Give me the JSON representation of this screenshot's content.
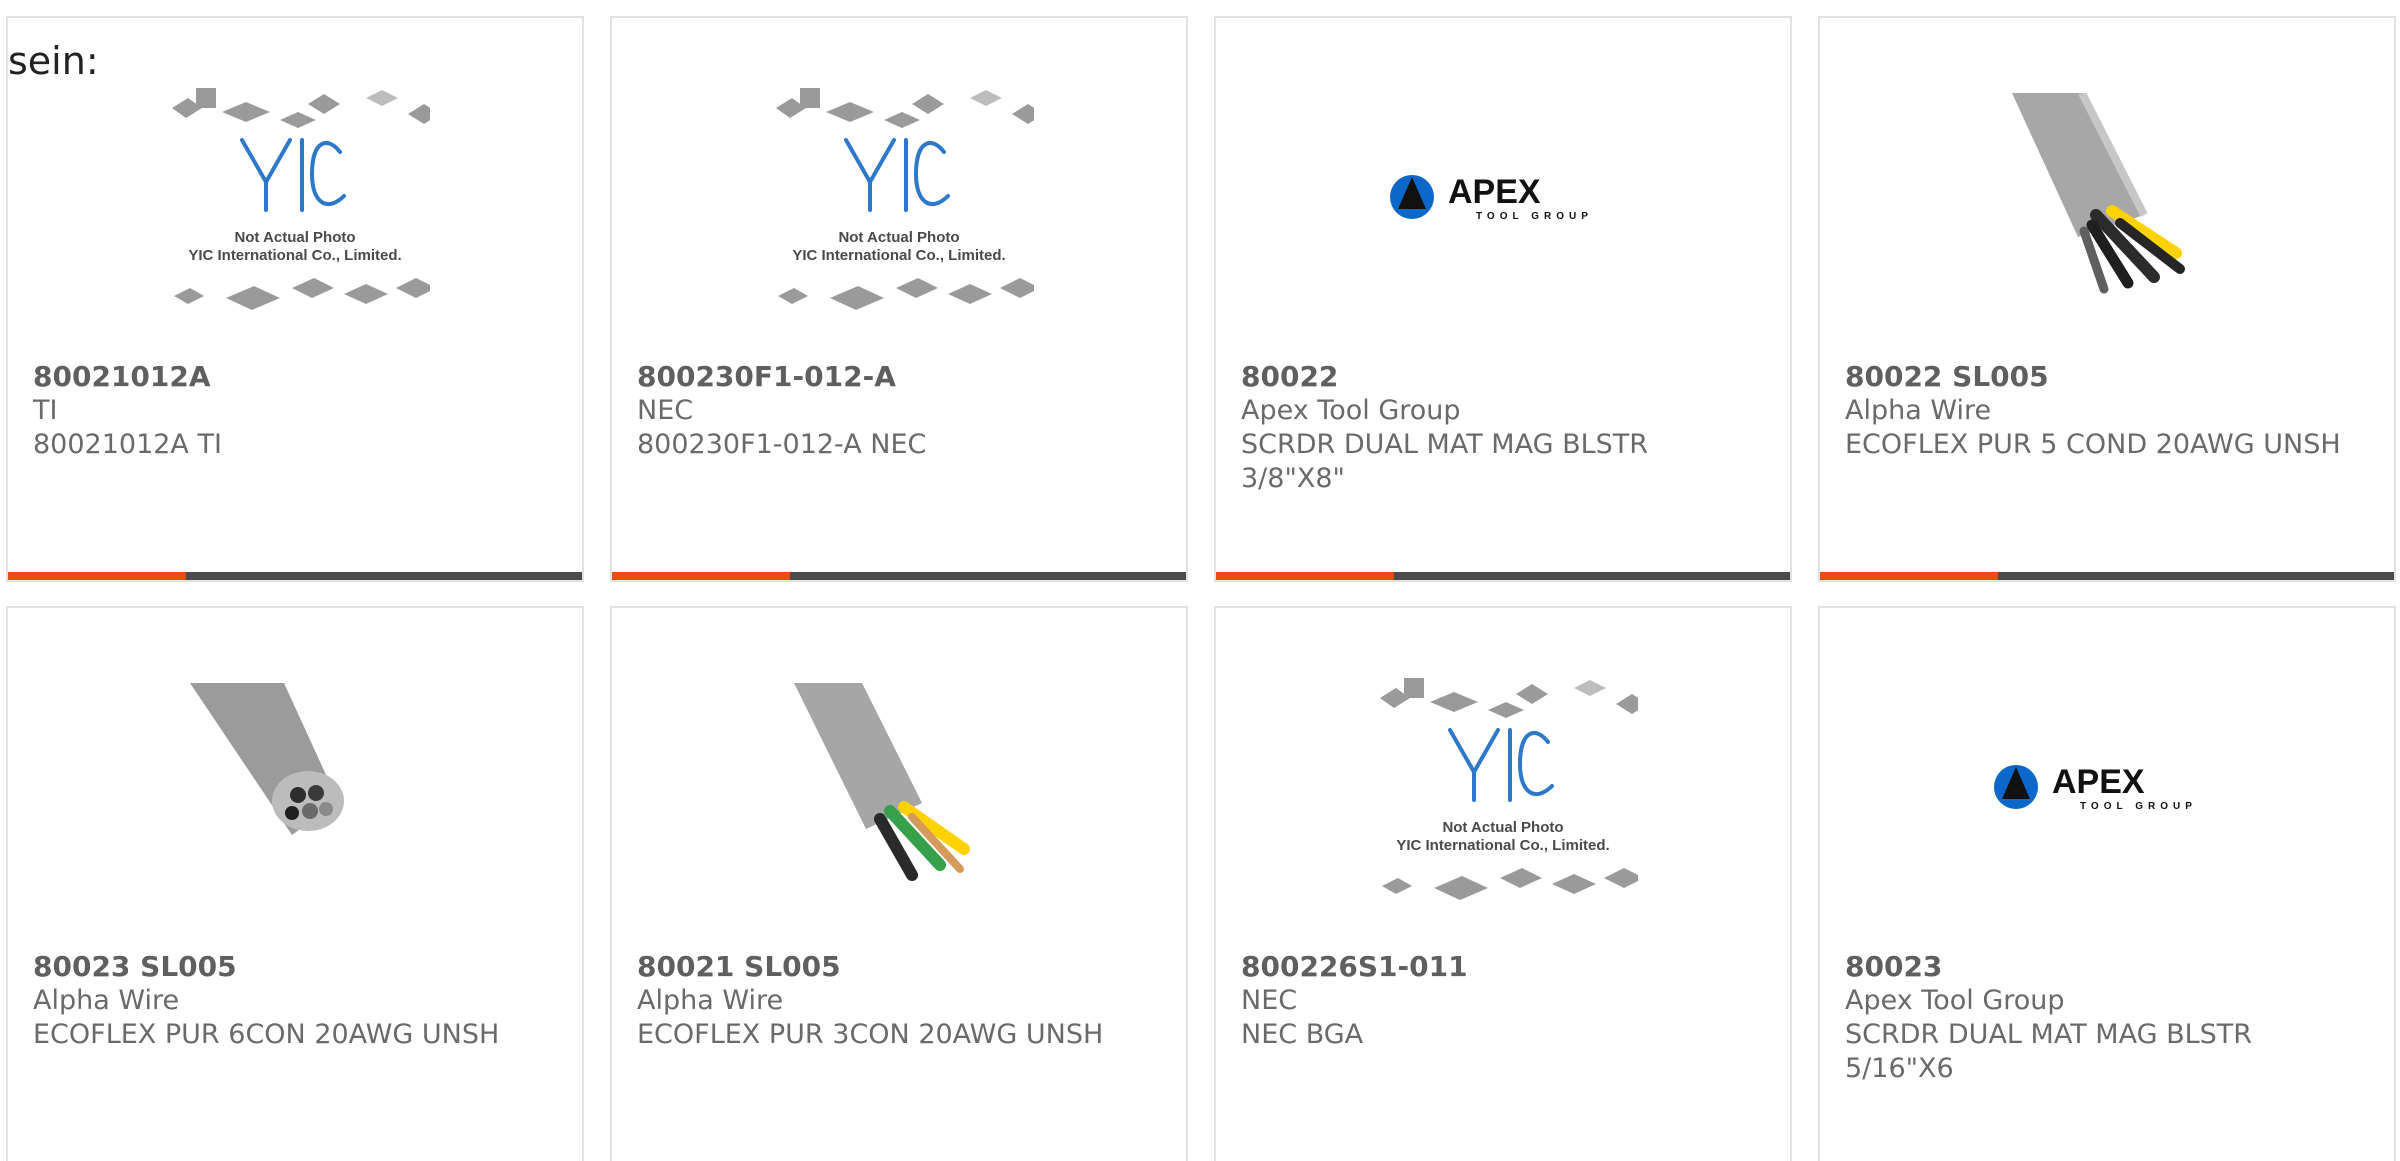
{
  "intro": "sein:",
  "products": [
    {
      "part_number": "80021012A",
      "brand": "TI",
      "description": "80021012A TI",
      "image": "yic-placeholder",
      "placeholder_text": [
        "Not Actual Photo",
        "YIC International Co., Limited."
      ]
    },
    {
      "part_number": "800230F1-012-A",
      "brand": "NEC",
      "description": "800230F1-012-A NEC",
      "image": "yic-placeholder",
      "placeholder_text": [
        "Not Actual Photo",
        "YIC International Co., Limited."
      ]
    },
    {
      "part_number": "80022",
      "brand": "Apex Tool Group",
      "description": "SCRDR DUAL MAT MAG BLSTR 3/8\"X8\"",
      "image": "apex-logo",
      "logo_text": [
        "APEX",
        "TOOL GROUP"
      ]
    },
    {
      "part_number": "80022 SL005",
      "brand": "Alpha Wire",
      "description": "ECOFLEX PUR 5 COND 20AWG UNSH",
      "image": "gray-cable-yellow"
    },
    {
      "part_number": "80023 SL005",
      "brand": "Alpha Wire",
      "description": "ECOFLEX PUR 6CON 20AWG UNSH",
      "image": "gray-cable-end"
    },
    {
      "part_number": "80021 SL005",
      "brand": "Alpha Wire",
      "description": "ECOFLEX PUR 3CON 20AWG UNSH",
      "image": "gray-cable-green"
    },
    {
      "part_number": "800226S1-011",
      "brand": "NEC",
      "description": "NEC BGA",
      "image": "yic-placeholder",
      "placeholder_text": [
        "Not Actual Photo",
        "YIC International Co., Limited."
      ]
    },
    {
      "part_number": "80023",
      "brand": "Apex Tool Group",
      "description": "SCRDR DUAL MAT MAG BLSTR 5/16\"X6",
      "image": "apex-logo",
      "logo_text": [
        "APEX",
        "TOOL GROUP"
      ]
    }
  ],
  "colors": {
    "accent": "#ec4d13",
    "bar": "#4b4b4b",
    "text": "#6a6a6a",
    "yic_blue": "#2d78c8"
  }
}
